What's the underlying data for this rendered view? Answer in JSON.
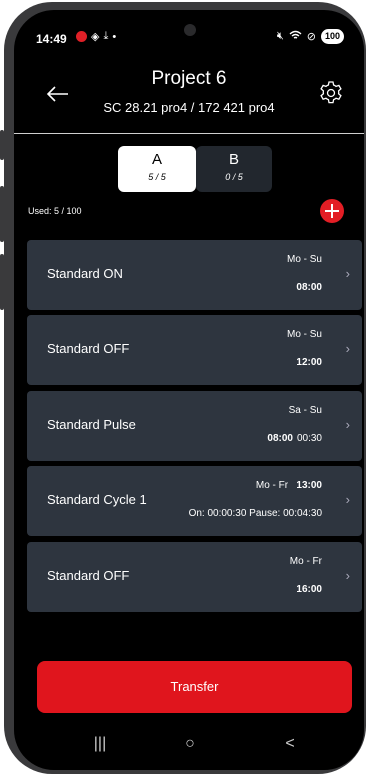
{
  "status_bar": {
    "time": "14:49",
    "left_icons": [
      "app-notification-icon",
      "nfc-icon",
      "download-icon",
      "dot-icon"
    ],
    "right_icons": [
      "mute-icon",
      "wifi-icon",
      "do-not-disturb-icon"
    ],
    "battery": "100"
  },
  "header": {
    "title": "Project 6",
    "subtitle": "SC 28.21 pro4 / 172 421 pro4"
  },
  "segments": [
    {
      "letter": "A",
      "count": "5 / 5",
      "selected": true
    },
    {
      "letter": "B",
      "count": "0 / 5",
      "selected": false
    }
  ],
  "used": "Used:  5 / 100",
  "programs": [
    {
      "name": "Standard ON",
      "days": "Mo - Su",
      "time": "08:00"
    },
    {
      "name": "Standard OFF",
      "days": "Mo - Su",
      "time": "12:00"
    },
    {
      "name": "Standard Pulse",
      "days": "Sa - Su",
      "time": "08:00",
      "duration": "00:30"
    },
    {
      "name": "Standard Cycle 1",
      "days": "Mo - Fr",
      "time": "13:00",
      "detail": "On: 00:00:30  Pause: 00:04:30"
    },
    {
      "name": "Standard OFF",
      "days": "Mo - Fr",
      "time": "16:00"
    }
  ],
  "transfer_label": "Transfer",
  "nav": {
    "recents": "|||",
    "home": "○",
    "back": "<"
  },
  "colors": {
    "accent": "#e0151d",
    "card": "#2e353f",
    "background": "#000000"
  }
}
